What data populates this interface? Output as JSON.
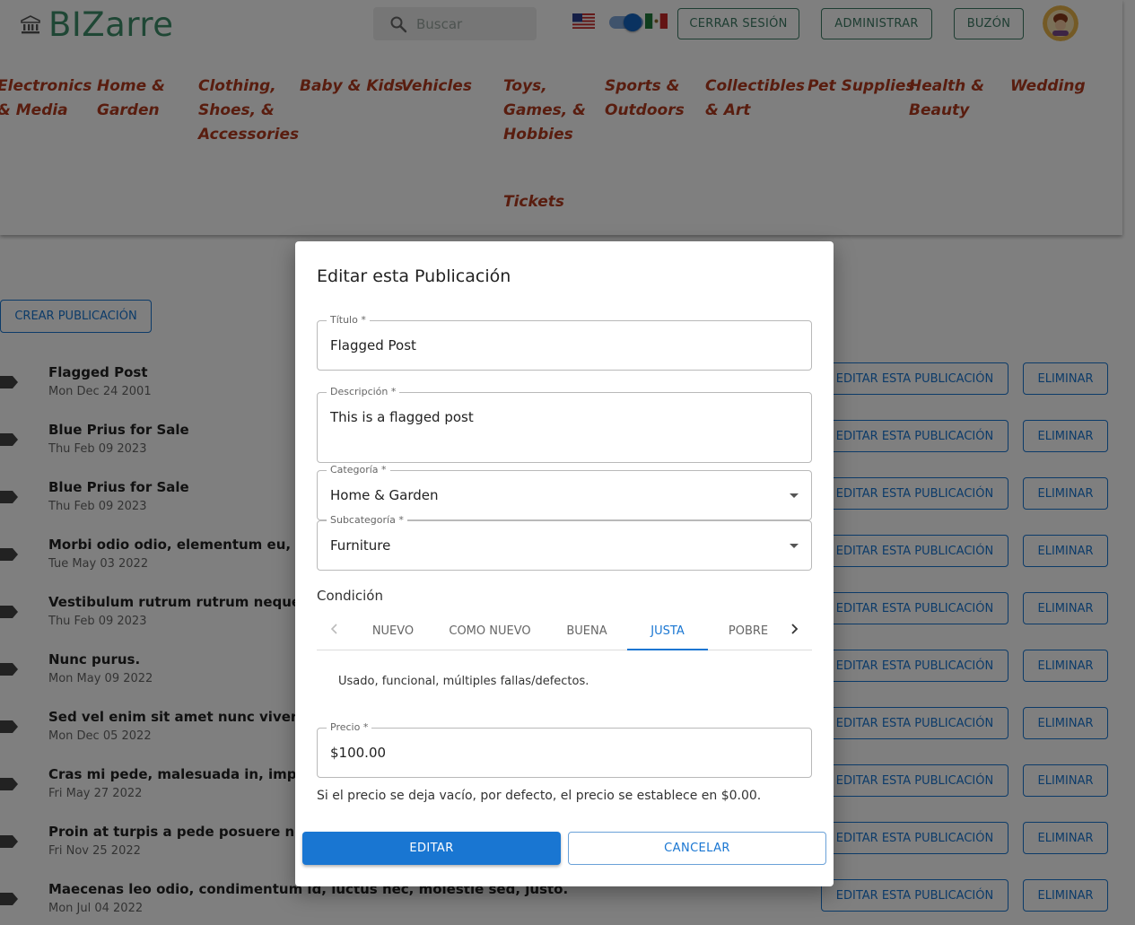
{
  "header": {
    "logo_text": "BIZarre",
    "search_placeholder": "Buscar",
    "buttons": {
      "logout": "CERRAR SESIÓN",
      "admin": "ADMINISTRAR",
      "inbox": "BUZÓN"
    },
    "categories": [
      [
        "Electronics",
        "& Media"
      ],
      [
        "Home &",
        "Garden"
      ],
      [
        "Clothing,",
        "Shoes, &",
        "Accessories"
      ],
      [
        "Baby & Kids"
      ],
      [
        "Vehicles"
      ],
      [
        "Toys,",
        "Games, &",
        "Hobbies"
      ],
      [
        "Sports &",
        "Outdoors"
      ],
      [
        "Collectibles",
        "& Art"
      ],
      [
        "Pet Supplies"
      ],
      [
        "Health &",
        "Beauty"
      ],
      [
        "Wedding"
      ],
      [
        "Tickets"
      ]
    ]
  },
  "main": {
    "create_button": "CREAR PUBLICACIÓN",
    "edit_label": "EDITAR ESTA PUBLICACIÓN",
    "delete_label": "ELIMINAR",
    "posts": [
      {
        "title": "Flagged Post",
        "date": "Mon Dec 24 2001"
      },
      {
        "title": "Blue Prius for Sale",
        "date": "Thu Feb 09 2023"
      },
      {
        "title": "Blue Prius for Sale",
        "date": "Thu Feb 09 2023"
      },
      {
        "title": "Morbi odio odio, elementum eu, interdu",
        "date": "Tue May 03 2022"
      },
      {
        "title": "Vestibulum rutrum rutrum neque.",
        "date": "Thu Feb 09 2023"
      },
      {
        "title": "Nunc purus.",
        "date": "Mon May 09 2022"
      },
      {
        "title": "Sed vel enim sit amet nunc viverra dapi",
        "date": "Mon Dec 05 2022"
      },
      {
        "title": "Cras mi pede, malesuada in, imperdiet",
        "date": "Fri May 27 2022"
      },
      {
        "title": "Proin at turpis a pede posuere nonumm",
        "date": "Fri Nov 25 2022"
      },
      {
        "title": "Maecenas leo odio, condimentum id, luctus nec, molestie sed, justo.",
        "date": "Mon Jul 04 2022"
      }
    ]
  },
  "dialog": {
    "title": "Editar esta Publicación",
    "fields": {
      "titulo": {
        "label": "Título *",
        "value": "Flagged Post"
      },
      "descripcion": {
        "label": "Descripción *",
        "value": "This is a flagged post"
      },
      "categoria": {
        "label": "Categoría *",
        "value": "Home & Garden"
      },
      "subcategoria": {
        "label": "Subcategoría *",
        "value": "Furniture"
      },
      "precio": {
        "label": "Precio *",
        "value": "$100.00"
      }
    },
    "condition_label": "Condición",
    "condition_tabs": [
      "NUEVO",
      "COMO NUEVO",
      "BUENA",
      "JUSTA",
      "POBRE"
    ],
    "condition_selected": "JUSTA",
    "condition_description": "Usado, funcional, múltiples fallas/defectos.",
    "price_help": "Si el precio se deja vacío, por defecto, el precio se establece en $0.00.",
    "submit_label": "EDITAR",
    "cancel_label": "CANCELAR"
  },
  "icons": [
    "bank-icon",
    "search-icon",
    "us-flag-icon",
    "mx-flag-icon",
    "tag-icon",
    "chevron-left-icon",
    "chevron-right-icon",
    "dropdown-caret-icon"
  ],
  "colors": {
    "brand": "#3f8f6a",
    "category": "#b23a1f",
    "primary": "#1976d2"
  }
}
